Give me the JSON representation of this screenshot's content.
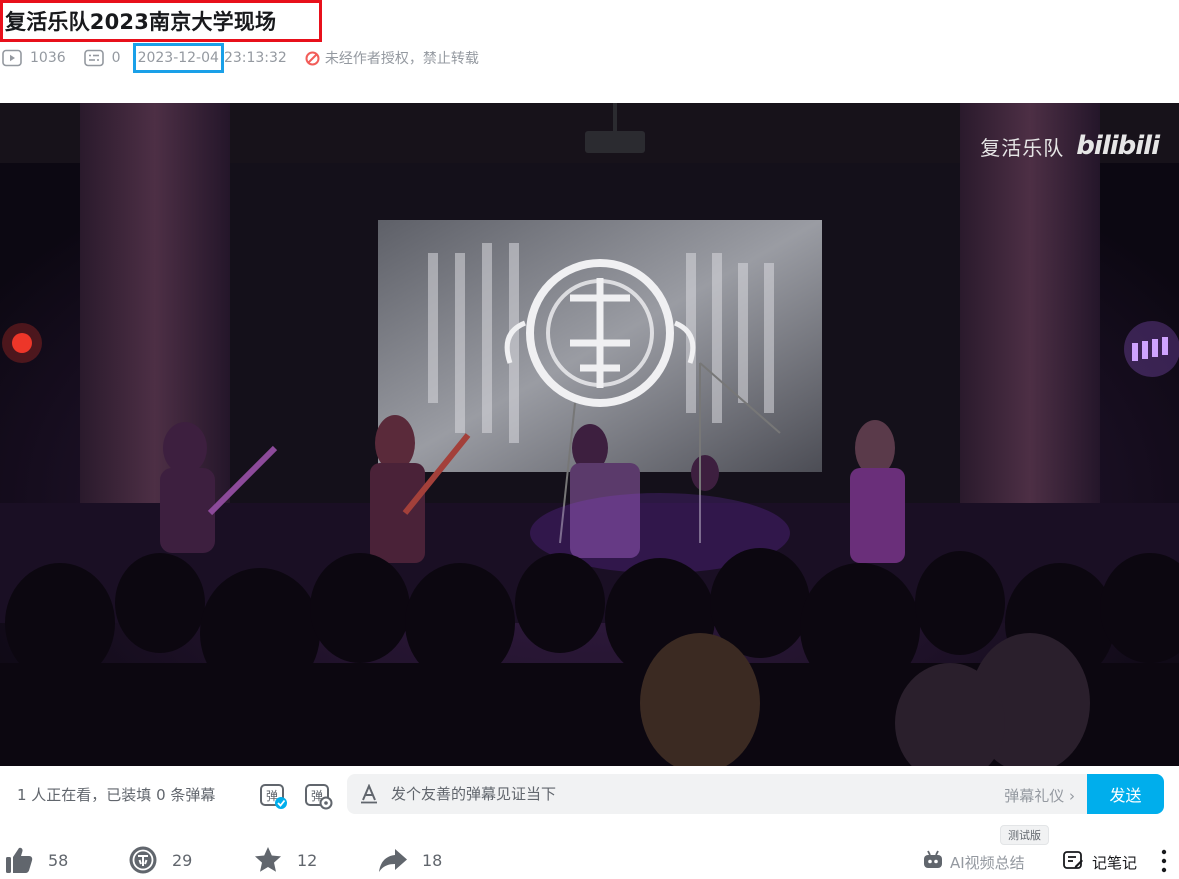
{
  "video": {
    "title": "复活乐队2023南京大学现场",
    "play_count": "1036",
    "danmaku_count": "0",
    "date": "2023-12-04",
    "time": "23:13:32",
    "copyright_notice": "未经作者授权，禁止转载",
    "watermark_name": "复活乐队",
    "watermark_logo": "bilibili"
  },
  "danmaku_bar": {
    "status": "1 人正在看，已装填 0 条弹幕",
    "input_placeholder": "发个友善的弹幕见证当下",
    "etiquette_label": "弹幕礼仪 ›",
    "send_label": "发送"
  },
  "actions": {
    "like_count": "58",
    "coin_count": "29",
    "favorite_count": "12",
    "share_count": "18",
    "beta_tag": "测试版",
    "ai_summary_label": "AI视频总结",
    "notes_label": "记笔记"
  },
  "icons": [
    "play-count-icon",
    "danmaku-count-icon",
    "no-repost-icon",
    "danmaku-toggle-icon",
    "danmaku-setting-icon",
    "font-style-icon",
    "like-icon",
    "coin-icon",
    "favorite-icon",
    "share-icon",
    "ai-robot-icon",
    "notes-icon",
    "more-icon"
  ],
  "colors": {
    "accent": "#00aeec",
    "title_highlight": "#e8101b",
    "date_highlight": "#1aa0e8",
    "warning": "#f25d59"
  }
}
